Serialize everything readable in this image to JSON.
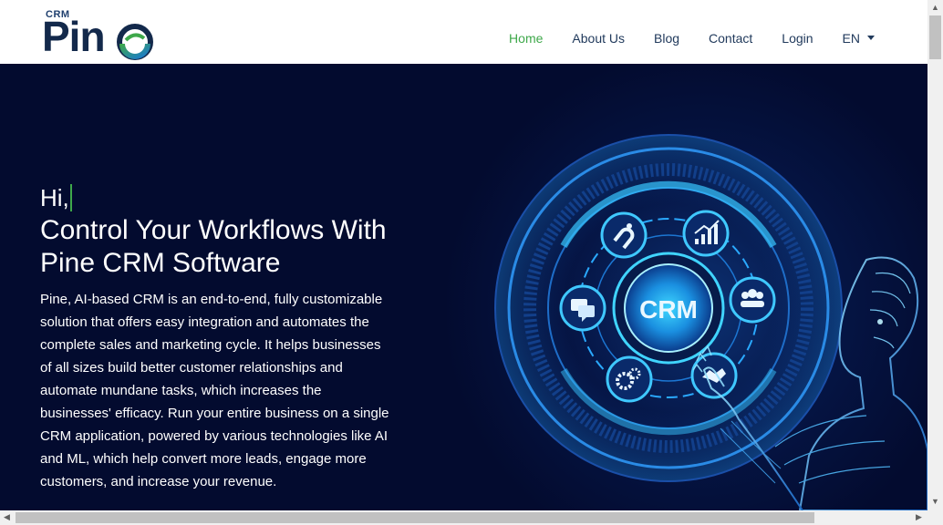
{
  "logo": {
    "small": "CRM",
    "main": "Pin"
  },
  "nav": {
    "items": [
      {
        "label": "Home",
        "active": true
      },
      {
        "label": "About Us"
      },
      {
        "label": "Blog"
      },
      {
        "label": "Contact"
      },
      {
        "label": "Login"
      }
    ],
    "language": "EN"
  },
  "hero": {
    "greeting": "Hi,",
    "title": "Control Your Workflows With Pine CRM Software",
    "description": "Pine, AI-based CRM is an end-to-end, fully customizable solution that offers easy integration and automates the complete sales and marketing cycle. It helps businesses of all sizes build better customer relationships and automate mundane tasks, which increases the businesses' efficacy. Run your entire business on a single CRM application, powered by various technologies like AI and ML, which help convert more leads, engage more customers, and increase your revenue."
  },
  "illustration": {
    "center_label": "CRM"
  },
  "colors": {
    "accent": "#3ea84a",
    "hero_bg": "#030b2f",
    "nav_text": "#213a5c",
    "glow": "#1ec8ff"
  },
  "icons": [
    "magnet-icon",
    "growth-chart-icon",
    "team-icon",
    "handshake-icon",
    "gears-icon",
    "chat-icon"
  ]
}
